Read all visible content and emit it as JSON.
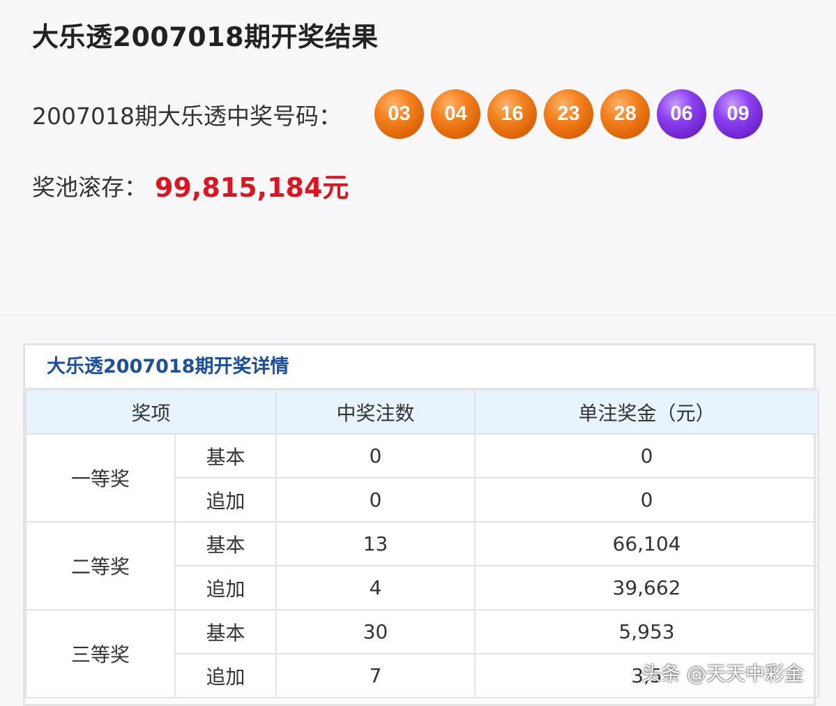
{
  "header": {
    "title": "大乐透2007018期开奖结果",
    "numbers_label": "2007018期大乐透中奖号码：",
    "front_numbers": [
      "03",
      "04",
      "16",
      "23",
      "28"
    ],
    "back_numbers": [
      "06",
      "09"
    ],
    "pool_label": "奖池滚存：",
    "pool_value": "99,815,184元"
  },
  "detail": {
    "title": "大乐透2007018期开奖详情",
    "columns": [
      "奖项",
      "中奖注数",
      "单注奖金（元）"
    ],
    "groups": [
      {
        "name": "一等奖",
        "rows": [
          {
            "type": "基本",
            "count": "0",
            "amount": "0"
          },
          {
            "type": "追加",
            "count": "0",
            "amount": "0"
          }
        ]
      },
      {
        "name": "二等奖",
        "rows": [
          {
            "type": "基本",
            "count": "13",
            "amount": "66,104"
          },
          {
            "type": "追加",
            "count": "4",
            "amount": "39,662"
          }
        ]
      },
      {
        "name": "三等奖",
        "rows": [
          {
            "type": "基本",
            "count": "30",
            "amount": "5,953"
          },
          {
            "type": "追加",
            "count": "7",
            "amount": "3,5"
          }
        ]
      }
    ]
  },
  "watermark": "头条 @天天中彩金",
  "colors": {
    "front_ball": "#f5821f",
    "back_ball": "#8b3ff0",
    "pool_value": "#e0141e",
    "detail_title": "#1a4ea0",
    "table_header_bg": "#e8f4fd"
  }
}
